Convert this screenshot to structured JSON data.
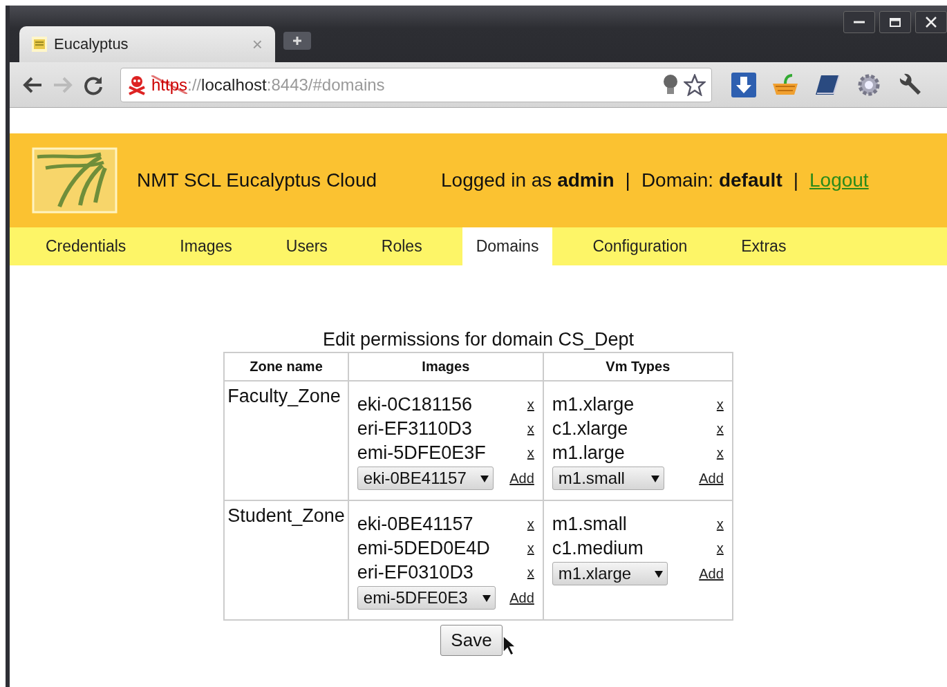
{
  "browser": {
    "tab": {
      "title": "Eucalyptus",
      "close": "×",
      "selected": true
    },
    "address": {
      "insecure": true,
      "scheme": "https",
      "separator": "://",
      "host": "localhost",
      "path": ":8443/#domains"
    },
    "forward_disabled": true
  },
  "header": {
    "title": "NMT SCL Eucalyptus Cloud",
    "user": "Logged in as **admin**",
    "separator_1": "|",
    "domain": "Domain: **default**",
    "separator_2": "|",
    "logout": "Logout"
  },
  "tabs": [
    {
      "label": "Credentials",
      "selected": false
    },
    {
      "label": "Images",
      "selected": false
    },
    {
      "label": "Users",
      "selected": false
    },
    {
      "label": "Roles",
      "selected": false
    },
    {
      "label": "Domains",
      "selected": true
    },
    {
      "label": "Configuration",
      "selected": false
    },
    {
      "label": "Extras",
      "selected": false
    }
  ],
  "permissions": {
    "title": "Edit permissions for domain CS_Dept",
    "columns": [
      "Zone name",
      "Images",
      "Vm Types"
    ],
    "rows": [
      {
        "zone": "Faculty_Zone",
        "images": [
          {
            "name": "eki-0C181156",
            "remove": "x"
          },
          {
            "name": "eri-EF3110D3",
            "remove": "x"
          },
          {
            "name": "emi-5DFE0E3F",
            "remove": "x"
          }
        ],
        "image_select": "eki-0BE41157",
        "image_add": "Add",
        "vm_types": [
          {
            "name": "m1.xlarge",
            "remove": "x"
          },
          {
            "name": "c1.xlarge",
            "remove": "x"
          },
          {
            "name": "m1.large",
            "remove": "x"
          }
        ],
        "vm_select": "m1.small",
        "vm_add": "Add"
      },
      {
        "zone": "Student_Zone",
        "images": [
          {
            "name": "eki-0BE41157",
            "remove": "x"
          },
          {
            "name": "emi-5DED0E4D",
            "remove": "x"
          },
          {
            "name": "eri-EF0310D3",
            "remove": "x"
          }
        ],
        "image_select": "emi-5DFE0E3",
        "image_add": "Add",
        "vm_types": [
          {
            "name": "m1.small",
            "remove": "x"
          },
          {
            "name": "c1.medium",
            "remove": "x"
          }
        ],
        "vm_select": "m1.xlarge",
        "vm_add": "Add"
      }
    ],
    "save": "Save"
  }
}
